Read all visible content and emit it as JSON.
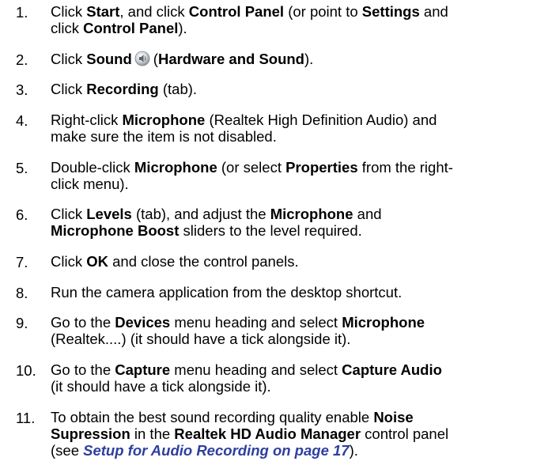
{
  "steps": [
    {
      "number": "1.",
      "lines": [
        [
          {
            "t": "Click ",
            "b": false
          },
          {
            "t": "Start",
            "b": true
          },
          {
            "t": ", and click ",
            "b": false
          },
          {
            "t": "Control Panel",
            "b": true
          },
          {
            "t": " (or point to ",
            "b": false
          },
          {
            "t": "Settings",
            "b": true
          },
          {
            "t": " and",
            "b": false
          }
        ],
        [
          {
            "t": "click ",
            "b": false
          },
          {
            "t": "Control Panel",
            "b": true
          },
          {
            "t": ").",
            "b": false
          }
        ]
      ]
    },
    {
      "number": "2.",
      "lines": [
        [
          {
            "t": "Click ",
            "b": false
          },
          {
            "t": "Sound",
            "b": true
          },
          {
            "icon": "speaker-icon"
          },
          {
            "t": "(",
            "b": false
          },
          {
            "t": "Hardware and Sound",
            "b": true
          },
          {
            "t": ").",
            "b": false
          }
        ]
      ]
    },
    {
      "number": "3.",
      "lines": [
        [
          {
            "t": "Click ",
            "b": false
          },
          {
            "t": "Recording",
            "b": true
          },
          {
            "t": " (tab).",
            "b": false
          }
        ]
      ]
    },
    {
      "number": "4.",
      "lines": [
        [
          {
            "t": "Right-click ",
            "b": false
          },
          {
            "t": "Microphone",
            "b": true
          },
          {
            "t": " (Realtek High Definition Audio) and",
            "b": false
          }
        ],
        [
          {
            "t": "make sure the item is not disabled.",
            "b": false
          }
        ]
      ]
    },
    {
      "number": "5.",
      "lines": [
        [
          {
            "t": "Double-click ",
            "b": false
          },
          {
            "t": "Microphone",
            "b": true
          },
          {
            "t": " (or select ",
            "b": false
          },
          {
            "t": "Properties",
            "b": true
          },
          {
            "t": " from the right-",
            "b": false
          }
        ],
        [
          {
            "t": "click menu).",
            "b": false
          }
        ]
      ]
    },
    {
      "number": "6.",
      "lines": [
        [
          {
            "t": "Click ",
            "b": false
          },
          {
            "t": "Levels",
            "b": true
          },
          {
            "t": " (tab), and adjust the ",
            "b": false
          },
          {
            "t": "Microphone",
            "b": true
          },
          {
            "t": " and",
            "b": false
          }
        ],
        [
          {
            "t": "Microphone Boost",
            "b": true
          },
          {
            "t": " sliders to the level required.",
            "b": false
          }
        ]
      ]
    },
    {
      "number": "7.",
      "lines": [
        [
          {
            "t": "Click ",
            "b": false
          },
          {
            "t": "OK",
            "b": true
          },
          {
            "t": " and close the control panels.",
            "b": false
          }
        ]
      ]
    },
    {
      "number": "8.",
      "lines": [
        [
          {
            "t": "Run the camera application from the desktop shortcut.",
            "b": false
          }
        ]
      ]
    },
    {
      "number": "9.",
      "lines": [
        [
          {
            "t": "Go to the ",
            "b": false
          },
          {
            "t": "Devices",
            "b": true
          },
          {
            "t": " menu heading and select ",
            "b": false
          },
          {
            "t": "Microphone",
            "b": true
          }
        ],
        [
          {
            "t": "(Realtek....) (it should have a tick alongside it).",
            "b": false
          }
        ]
      ]
    },
    {
      "number": "10.",
      "lines": [
        [
          {
            "t": "Go to the ",
            "b": false
          },
          {
            "t": "Capture",
            "b": true
          },
          {
            "t": " menu heading and select ",
            "b": false
          },
          {
            "t": "Capture Audio",
            "b": true
          }
        ],
        [
          {
            "t": "(it should have a tick alongside it).",
            "b": false
          }
        ]
      ]
    },
    {
      "number": "11.",
      "lines": [
        [
          {
            "t": "To obtain the best sound recording quality enable ",
            "b": false
          },
          {
            "t": "Noise",
            "b": true
          }
        ],
        [
          {
            "t": "Supression",
            "b": true
          },
          {
            "t": " in the ",
            "b": false
          },
          {
            "t": "Realtek HD Audio Manager",
            "b": true
          },
          {
            "t": " control panel",
            "b": false
          }
        ],
        [
          {
            "t": "(see ",
            "b": false
          },
          {
            "t": "Setup for Audio Recording on page 17",
            "link": true
          },
          {
            "t": ").",
            "b": false
          }
        ]
      ]
    }
  ]
}
